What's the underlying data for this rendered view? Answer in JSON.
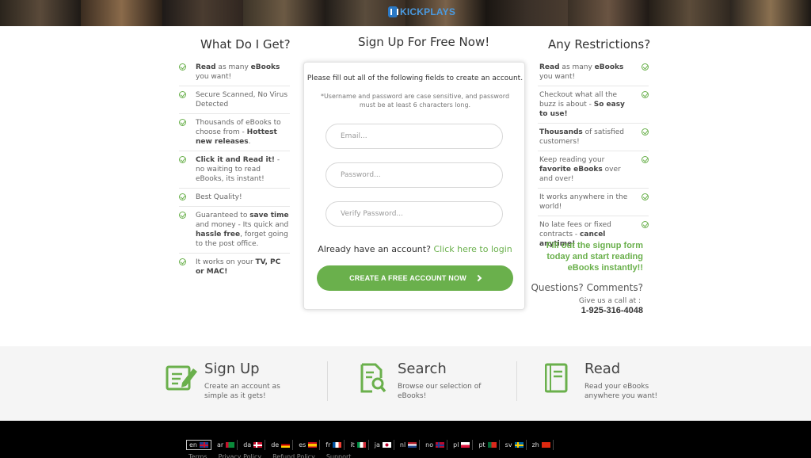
{
  "brand": {
    "name": "KICKPLAYS"
  },
  "left": {
    "title": "What Do I Get?",
    "features": [
      {
        "bold": "Read",
        "text": " as many ",
        "bold2": "eBooks",
        "text2": " you want!"
      },
      {
        "bold": "",
        "text": "Secure Scanned, No Virus Detected",
        "bold2": "",
        "text2": ""
      },
      {
        "bold": "",
        "text": "Thousands of eBooks to choose from - ",
        "bold2": "Hottest new releases",
        "text2": "."
      },
      {
        "bold": "Click it and Read it!",
        "text": " - no waiting to read eBooks, its instant!",
        "bold2": "",
        "text2": ""
      },
      {
        "bold": "",
        "text": "Best Quality!",
        "bold2": "",
        "text2": ""
      },
      {
        "bold": "",
        "text": "Guaranteed to ",
        "bold2": "save time",
        "text2": " and money - Its quick and ",
        "bold3": "hassle free",
        "text3": ", forget going to the post office."
      },
      {
        "bold": "",
        "text": "It works on your ",
        "bold2": "TV, PC or MAC!",
        "text2": ""
      }
    ]
  },
  "form": {
    "title": "Sign Up For Free Now!",
    "intro": "Please fill out all of the following fields to create an account.",
    "note": "*Username and password are case sensitive, and password must be at least 6 characters long.",
    "email_placeholder": "Email...",
    "password_placeholder": "Password...",
    "verify_placeholder": "Verify Password...",
    "login_prompt": "Already have an account?",
    "login_link": "Click here to login",
    "cta_label": "CREATE A FREE ACCOUNT NOW"
  },
  "right": {
    "title": "Any Restrictions?",
    "features": [
      {
        "bold": "Read",
        "text": " as many ",
        "bold2": "eBooks",
        "text2": " you want!"
      },
      {
        "bold": "",
        "text": "Checkout what all the buzz is about - ",
        "bold2": "So easy to use!",
        "text2": ""
      },
      {
        "bold": "Thousands",
        "text": " of satisfied customers!",
        "bold2": "",
        "text2": ""
      },
      {
        "bold": "",
        "text": "Keep reading your ",
        "bold2": "favorite eBooks",
        "text2": " over and over!"
      },
      {
        "bold": "",
        "text": "It works anywhere in the world!",
        "bold2": "",
        "text2": ""
      },
      {
        "bold": "",
        "text": "No late fees or fixed contracts - ",
        "bold2": "cancel anytime!",
        "text2": ""
      }
    ],
    "promo": "Fill out the signup form today and start reading eBooks instantly!!",
    "questions": "Questions? Comments?",
    "call_us": "Give us a call at :",
    "phone": "1-925-316-4048"
  },
  "steps": [
    {
      "title": "Sign Up",
      "desc": "Create an account as simple as it gets!",
      "icon": "sign-up-icon"
    },
    {
      "title": "Search",
      "desc": "Browse our selection of eBooks!",
      "icon": "search-document-icon"
    },
    {
      "title": "Read",
      "desc": "Read your eBooks anywhere you want!",
      "icon": "book-icon"
    }
  ],
  "footer": {
    "languages": [
      "en",
      "ar",
      "da",
      "de",
      "es",
      "fr",
      "it",
      "ja",
      "nl",
      "no",
      "pl",
      "pt",
      "sv",
      "zh"
    ],
    "links": [
      "Terms",
      "Privacy Policy",
      "Refund Policy",
      "Support"
    ]
  },
  "colors": {
    "accent": "#6ab04c",
    "brand": "#4a9ae0",
    "footer": "#000000",
    "steps_bg": "#f5f5f5"
  }
}
